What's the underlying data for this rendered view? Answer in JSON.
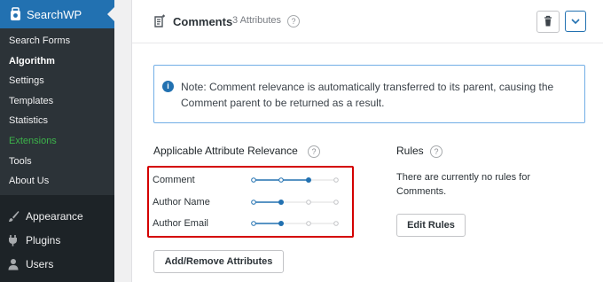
{
  "sidebar": {
    "plugin_title": "SearchWP",
    "submenu": [
      {
        "label": "Search Forms"
      },
      {
        "label": "Algorithm"
      },
      {
        "label": "Settings"
      },
      {
        "label": "Templates"
      },
      {
        "label": "Statistics"
      },
      {
        "label": "Extensions"
      },
      {
        "label": "Tools"
      },
      {
        "label": "About Us"
      }
    ],
    "menu": [
      {
        "label": "Appearance",
        "icon": "paintbrush-icon"
      },
      {
        "label": "Plugins",
        "icon": "plugin-icon"
      },
      {
        "label": "Users",
        "icon": "user-icon"
      }
    ]
  },
  "panel": {
    "title": "Comments",
    "count": "3 Attributes",
    "note": "Note: Comment relevance is automatically transferred to its parent, causing the Comment parent to be returned as a result.",
    "relevance": {
      "title": "Applicable Attribute Relevance",
      "attributes": [
        {
          "label": "Comment",
          "level": 3
        },
        {
          "label": "Author Name",
          "level": 2
        },
        {
          "label": "Author Email",
          "level": 2
        }
      ],
      "max_level": 4
    },
    "rules": {
      "title": "Rules",
      "text": "There are currently no rules for Comments.",
      "button": "Edit Rules"
    },
    "add_remove_button": "Add/Remove Attributes"
  },
  "colors": {
    "accent": "#2271b1",
    "sidebar_bg": "#1d2327",
    "submenu_bg": "#2c3338",
    "highlight_border": "#d40000",
    "extensions_green": "#3cb34a"
  }
}
